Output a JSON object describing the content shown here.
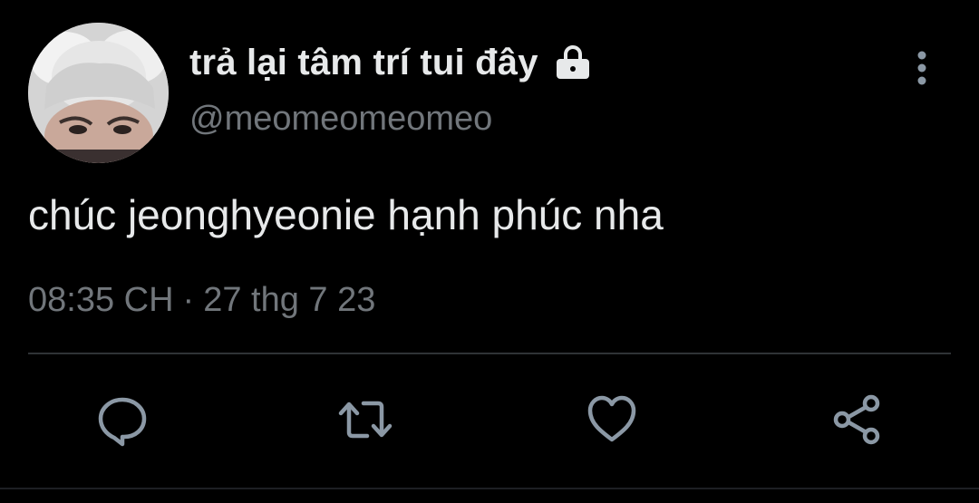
{
  "tweet": {
    "display_name": "trả lại tâm trí tui đây",
    "handle": "@meomeomeomeo",
    "protected_icon": "lock-icon",
    "text": "chúc jeonghyeonie hạnh phúc nha",
    "time": "08:35 CH",
    "separator": "·",
    "date": "27 thg 7 23"
  },
  "header": {
    "more_icon": "vertical-ellipsis-icon"
  },
  "actions": [
    {
      "name": "reply",
      "icon": "speech-bubble-icon"
    },
    {
      "name": "retweet",
      "icon": "retweet-arrows-icon"
    },
    {
      "name": "like",
      "icon": "heart-icon"
    },
    {
      "name": "share",
      "icon": "share-nodes-icon"
    }
  ],
  "colors": {
    "background": "#000000",
    "primary_text": "#e7e9ea",
    "secondary_text": "#71767b",
    "icon": "#8b98a5",
    "divider": "#2f3336"
  }
}
